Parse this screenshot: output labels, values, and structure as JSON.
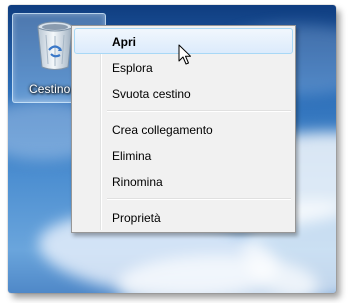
{
  "desktop": {
    "icon": {
      "label": "Cestino",
      "icon_name": "recycle-bin-icon"
    }
  },
  "context_menu": {
    "hover_color": "#dcebfc",
    "groups": [
      [
        {
          "label": "Apri",
          "default": true,
          "hovered": true
        },
        {
          "label": "Esplora"
        },
        {
          "label": "Svuota cestino"
        }
      ],
      [
        {
          "label": "Crea collegamento"
        },
        {
          "label": "Elimina"
        },
        {
          "label": "Rinomina"
        }
      ],
      [
        {
          "label": "Proprietà"
        }
      ]
    ]
  },
  "cursor": {
    "icon_name": "arrow-cursor-icon"
  }
}
